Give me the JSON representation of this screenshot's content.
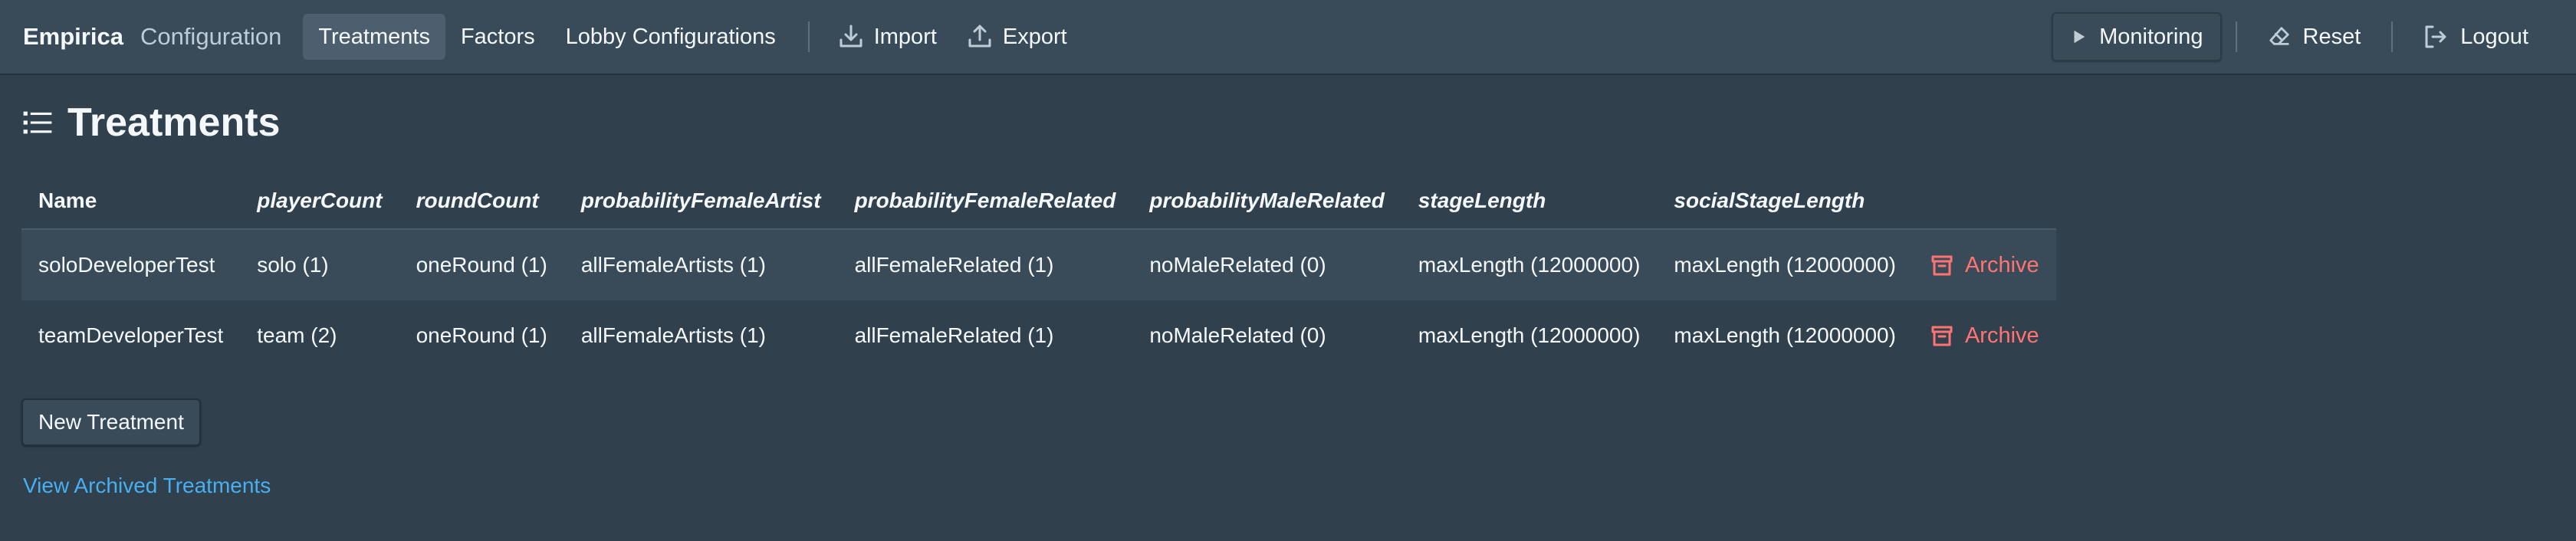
{
  "navbar": {
    "brand": "Empirica",
    "section": "Configuration",
    "tabs": [
      "Treatments",
      "Factors",
      "Lobby Configurations"
    ],
    "import_label": "Import",
    "export_label": "Export",
    "monitoring_label": "Monitoring",
    "reset_label": "Reset",
    "logout_label": "Logout"
  },
  "page": {
    "title": "Treatments"
  },
  "table": {
    "headers": [
      "Name",
      "playerCount",
      "roundCount",
      "probabilityFemaleArtist",
      "probabilityFemaleRelated",
      "probabilityMaleRelated",
      "stageLength",
      "socialStageLength"
    ],
    "rows": [
      [
        "soloDeveloperTest",
        "solo (1)",
        "oneRound (1)",
        "allFemaleArtists (1)",
        "allFemaleRelated (1)",
        "noMaleRelated (0)",
        "maxLength (12000000)",
        "maxLength (12000000)"
      ],
      [
        "teamDeveloperTest",
        "team (2)",
        "oneRound (1)",
        "allFemaleArtists (1)",
        "allFemaleRelated (1)",
        "noMaleRelated (0)",
        "maxLength (12000000)",
        "maxLength (12000000)"
      ]
    ],
    "archive_label": "Archive"
  },
  "actions": {
    "new_treatment": "New Treatment",
    "view_archived": "View Archived Treatments"
  },
  "colors": {
    "background": "#30404d",
    "navbar": "#394b59",
    "archive": "#ff7373",
    "link": "#48aff0"
  }
}
